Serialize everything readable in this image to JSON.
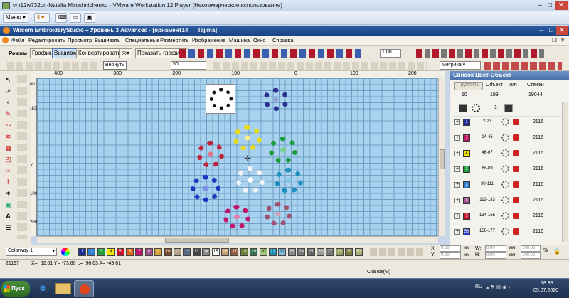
{
  "vm": {
    "title": "vm12w732pn-Natalia Miroshnichenko - VMware Workstation 12 Player (Некоммерческое использование)",
    "menu_label": "Меню"
  },
  "app": {
    "title": "Wilcom EmbroideryStudio – Уровень 3 Advanced - [орнамент14",
    "machine": "Tajima]"
  },
  "menu": [
    "Файл",
    "Редактировать",
    "Просмотр",
    "Вышивать",
    "Специальные",
    "Разместить",
    "Изображение",
    "Машина",
    "Окно",
    "Справка"
  ],
  "toolbar": {
    "mode_label": "Режим:",
    "graphics_label": "Графика",
    "embroidery_label": "Вышивка",
    "convert_label": "Конвертировать",
    "show_graphics_label": "Показать графику",
    "zoom_value": "1.00",
    "undo_label": "Вернуть",
    "zoom_percent": "50",
    "units_value": "Метрика"
  },
  "ruler": {
    "h_ticks": [
      "-400",
      "-300",
      "-200",
      "-100",
      "0",
      "100",
      "200"
    ],
    "v_ticks": [
      "00",
      "-100",
      "0",
      "100",
      "200"
    ]
  },
  "panel": {
    "title": "Список Цвет-Объект",
    "group_button": "Группить",
    "col_object": "Объект",
    "col_type": "Тип",
    "col_stitches": "Стежки",
    "header_nums": [
      "10",
      "199",
      "19044"
    ],
    "first_row_count": "1",
    "rows": [
      {
        "color": "#1c2d8f",
        "num": "1",
        "range": "2-23",
        "stitches": "2116"
      },
      {
        "color": "#c0156b",
        "num": "7",
        "range": "24-45",
        "stitches": "2116"
      },
      {
        "color": "#f2e600",
        "num": "4",
        "range": "46-67",
        "stitches": "2116"
      },
      {
        "color": "#1e9c3a",
        "num": "3",
        "range": "68-89",
        "stitches": "2116"
      },
      {
        "color": "#2e7fd0",
        "num": "2",
        "range": "90-111",
        "stitches": "2116"
      },
      {
        "color": "#a04e8a",
        "num": "8",
        "range": "112-133",
        "stitches": "2116"
      },
      {
        "color": "#c8102e",
        "num": "5",
        "range": "134-155",
        "stitches": "2116"
      },
      {
        "color": "#2a3bc9",
        "num": "56",
        "range": "156-177",
        "stitches": "2116"
      }
    ]
  },
  "bottom": {
    "colorway": "Colorway 1",
    "palette": [
      {
        "n": "1",
        "c": "#1c2d8f"
      },
      {
        "n": "2",
        "c": "#2e7fd0"
      },
      {
        "n": "3",
        "c": "#1e9c3a"
      },
      {
        "n": "4",
        "c": "#f2e600"
      },
      {
        "n": "5",
        "c": "#c8102e"
      },
      {
        "n": "6",
        "c": "#e06a1a"
      },
      {
        "n": "7",
        "c": "#c0156b"
      },
      {
        "n": "8",
        "c": "#a04e8a"
      },
      {
        "n": "9",
        "c": "#d9a23a"
      },
      {
        "n": "10",
        "c": "#7a4a2a"
      },
      {
        "n": "11",
        "c": "#b0a08a"
      },
      {
        "n": "12",
        "c": "#5a6a80"
      },
      {
        "n": "13",
        "c": "#444"
      },
      {
        "n": "14",
        "c": "#888"
      },
      {
        "n": "15",
        "c": "#ffffff"
      },
      {
        "n": "16",
        "c": "#c89f74"
      },
      {
        "n": "17",
        "c": "#8f5f3f"
      },
      {
        "n": "18",
        "c": "#6e7f3a"
      },
      {
        "n": "19",
        "c": "#2f6f4f"
      },
      {
        "n": "20",
        "c": "#a0c878"
      },
      {
        "n": "21",
        "c": "#1a8fb0"
      },
      {
        "n": "22",
        "c": "#7bbce0"
      },
      {
        "n": "23",
        "c": "#888"
      },
      {
        "n": "24",
        "c": "#777"
      },
      {
        "n": "25",
        "c": "#666"
      },
      {
        "n": "26",
        "c": "#999"
      },
      {
        "n": "27",
        "c": "#777"
      },
      {
        "n": "28",
        "c": "#9aa060"
      },
      {
        "n": "29",
        "c": "#7a7a3a"
      },
      {
        "n": "30",
        "c": "#a8b070"
      }
    ],
    "x_label": "X:",
    "y_label": "Y:",
    "w_label": "W:",
    "h_label": "H:",
    "x_val": "0.00",
    "y_val": "0.00",
    "w_val": "0.00",
    "h_val": "0.00",
    "unit_mm": "мм",
    "pct1": "100.00",
    "pct2": "100.00",
    "pct_sym": "%"
  },
  "status": {
    "count": "21197",
    "coords": "X=  62.61 Y= -73.60 L=  96.63 A= -49.61",
    "message": "Скачок(M)"
  },
  "taskbar": {
    "start": "Пуск",
    "lang": "RU",
    "time": "18:38",
    "date": "05.07.2020"
  }
}
